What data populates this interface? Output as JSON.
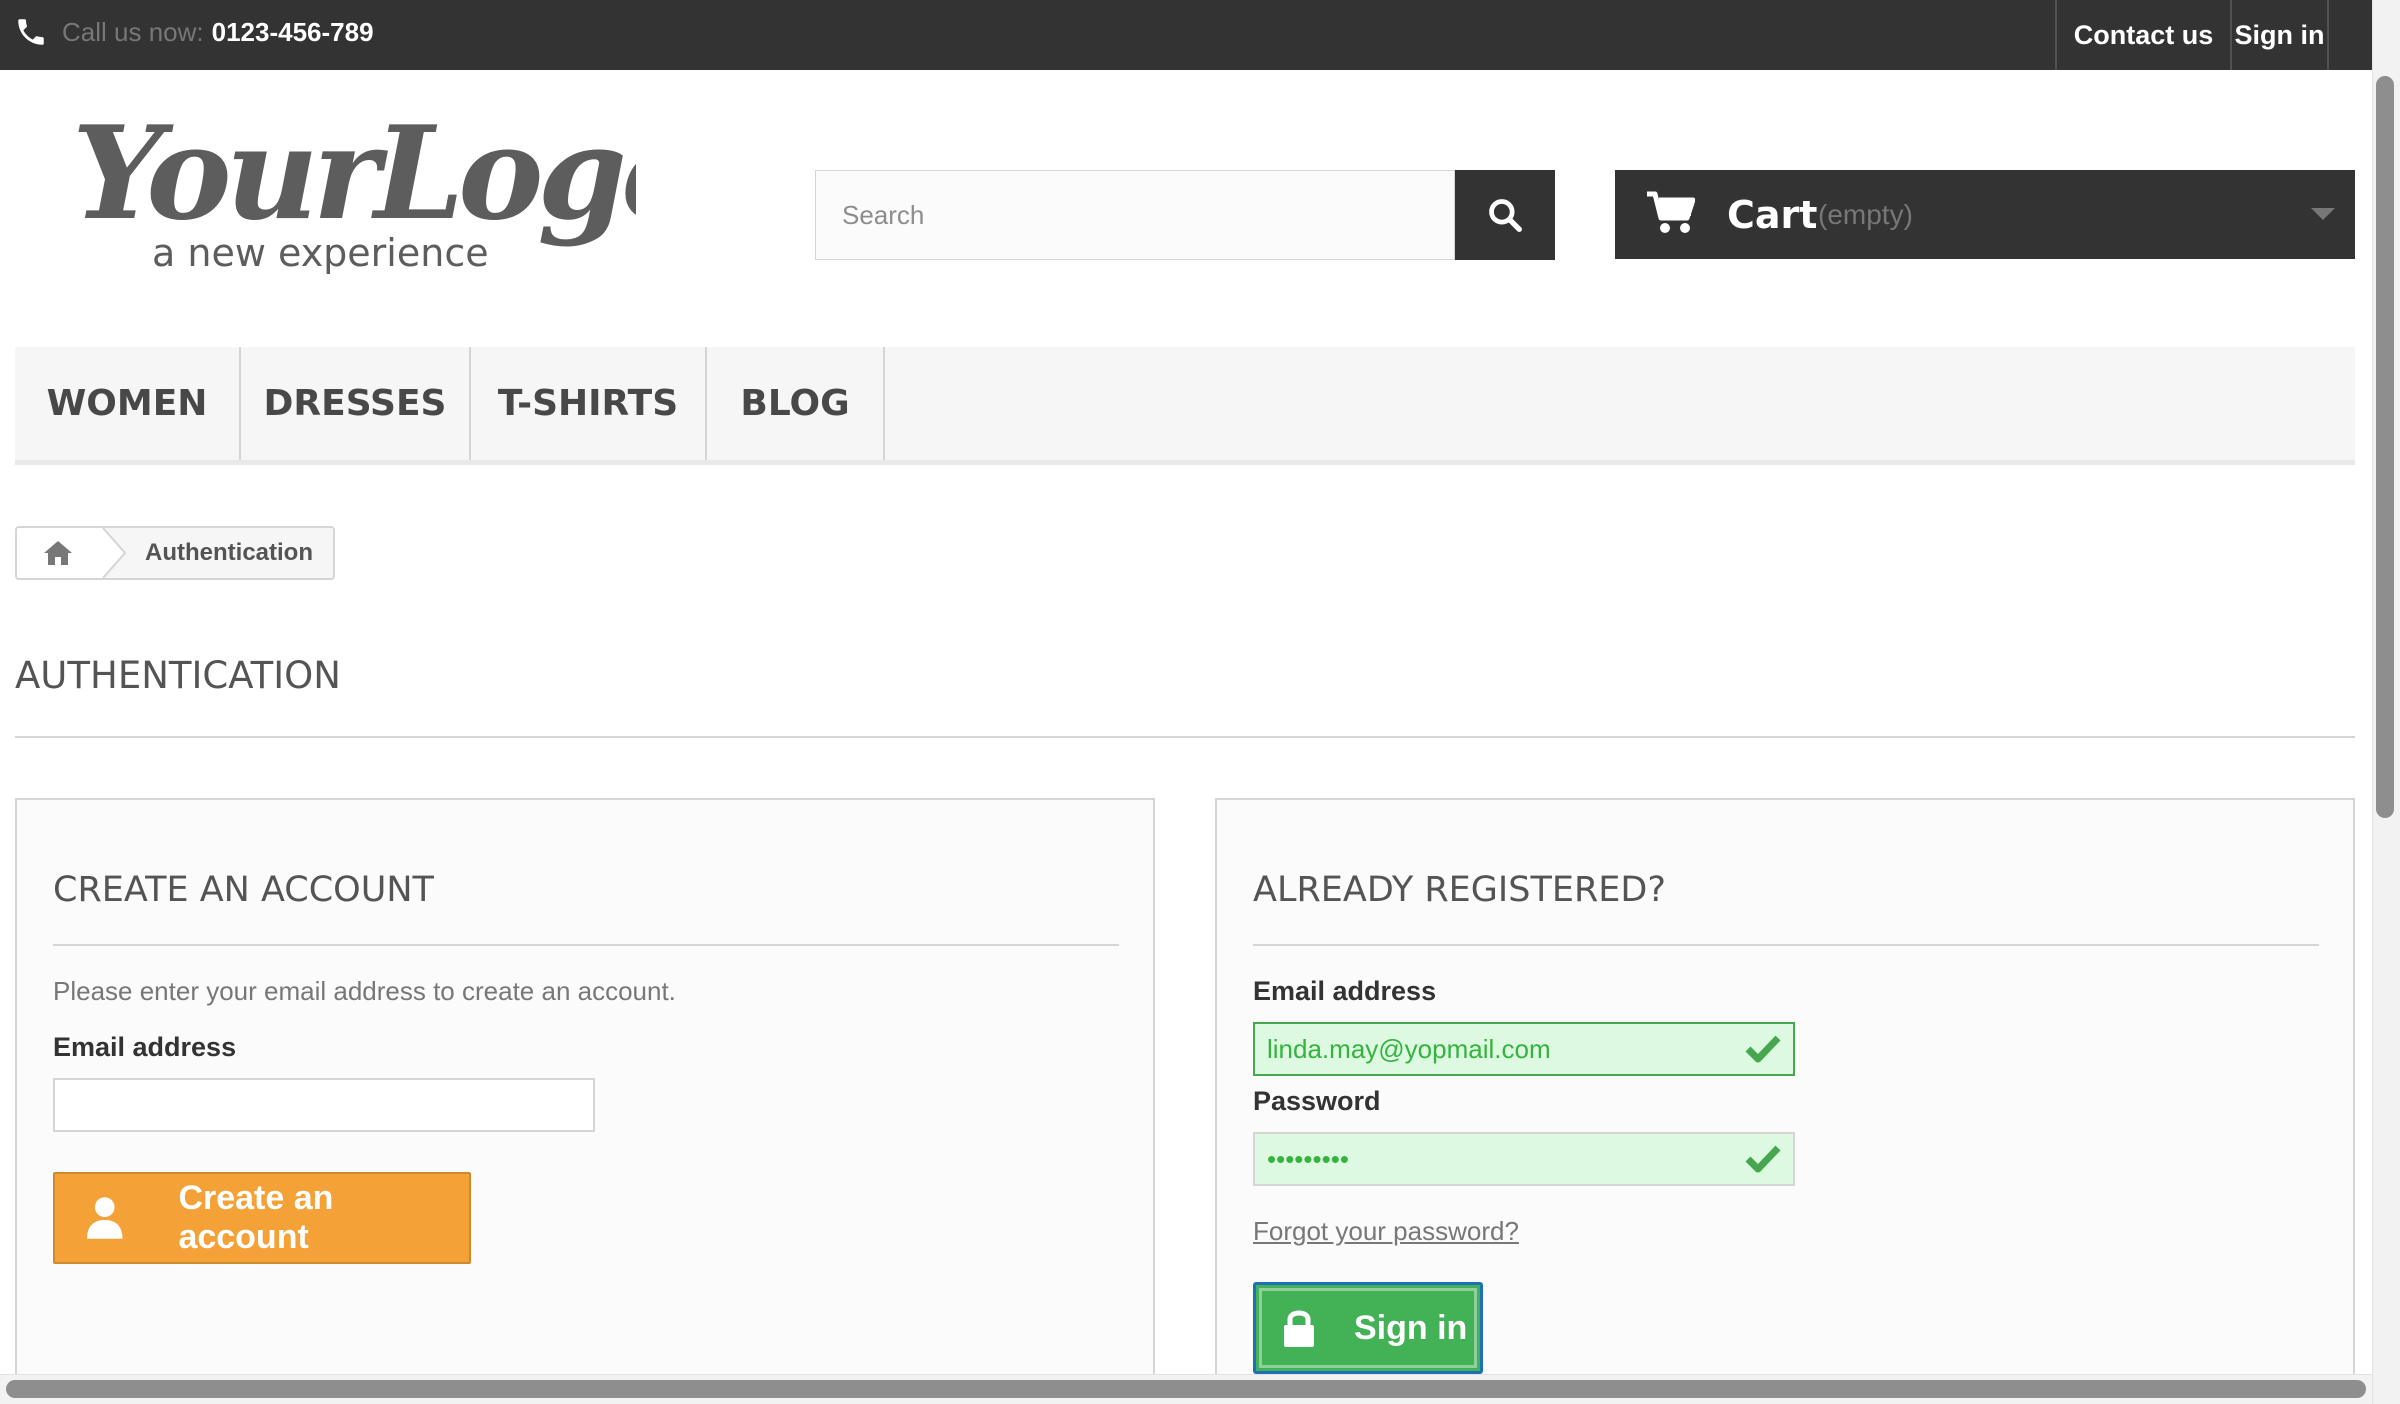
{
  "topbar": {
    "call_label": "Call us now:",
    "phone": "0123-456-789",
    "contact_label": "Contact us",
    "signin_label": "Sign in"
  },
  "header": {
    "logo_text": "YourLogo",
    "logo_tagline": "a new experience",
    "search_placeholder": "Search",
    "cart_label": "Cart",
    "cart_status": "(empty)"
  },
  "nav": {
    "items": [
      "WOMEN",
      "DRESSES",
      "T-SHIRTS",
      "BLOG"
    ]
  },
  "breadcrumb": {
    "current": "Authentication"
  },
  "page": {
    "title": "AUTHENTICATION"
  },
  "create_account": {
    "heading": "CREATE AN ACCOUNT",
    "intro": "Please enter your email address to create an account.",
    "email_label": "Email address",
    "email_value": "",
    "button_label": "Create an account"
  },
  "login": {
    "heading": "ALREADY REGISTERED?",
    "email_label": "Email address",
    "email_value": "linda.may@yopmail.com",
    "password_label": "Password",
    "password_value": "•••••••••",
    "forgot_label": "Forgot your password?",
    "button_label": "Sign in"
  },
  "colors": {
    "topbar_bg": "#333333",
    "accent_orange": "#f4a137",
    "accent_green": "#43b155",
    "valid_field_bg": "#ddf9e1"
  },
  "icons": {
    "phone": "phone-icon",
    "search": "search-icon",
    "cart": "cart-icon",
    "home": "home-icon",
    "user": "user-icon",
    "lock": "lock-icon",
    "check": "check-icon"
  }
}
